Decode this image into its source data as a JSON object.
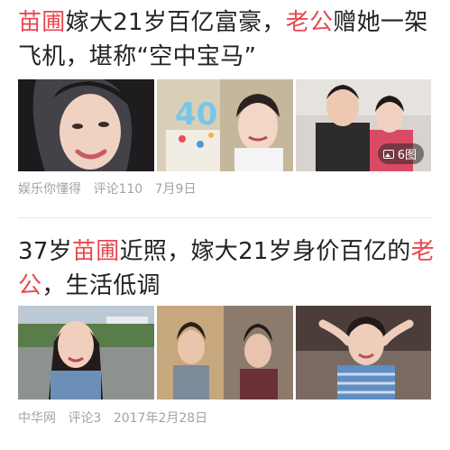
{
  "articles": [
    {
      "title_parts": [
        {
          "text": "苗圃",
          "highlight": true
        },
        {
          "text": "嫁大21岁百亿富豪，",
          "highlight": false
        },
        {
          "text": "老公",
          "highlight": true
        },
        {
          "text": "赠她一架飞机，堪称“空中宝马”",
          "highlight": false
        }
      ],
      "image_count_label": "6图",
      "source": "娱乐你懂得",
      "comments": "评论110",
      "date": "7月9日"
    },
    {
      "title_parts": [
        {
          "text": "37岁",
          "highlight": false
        },
        {
          "text": "苗圃",
          "highlight": true
        },
        {
          "text": "近照，嫁大21岁身价百亿的",
          "highlight": false
        },
        {
          "text": "老公",
          "highlight": true
        },
        {
          "text": "，生活低调",
          "highlight": false
        }
      ],
      "source": "中华网",
      "comments": "评论3",
      "date": "2017年2月28日"
    }
  ],
  "colors": {
    "highlight": "#e8484f",
    "meta_text": "#a3a3a3",
    "title_text": "#222222",
    "divider": "#e6e6e6"
  },
  "icons": {
    "image_count": "image-icon"
  },
  "decor": {
    "cake_number": "40"
  }
}
